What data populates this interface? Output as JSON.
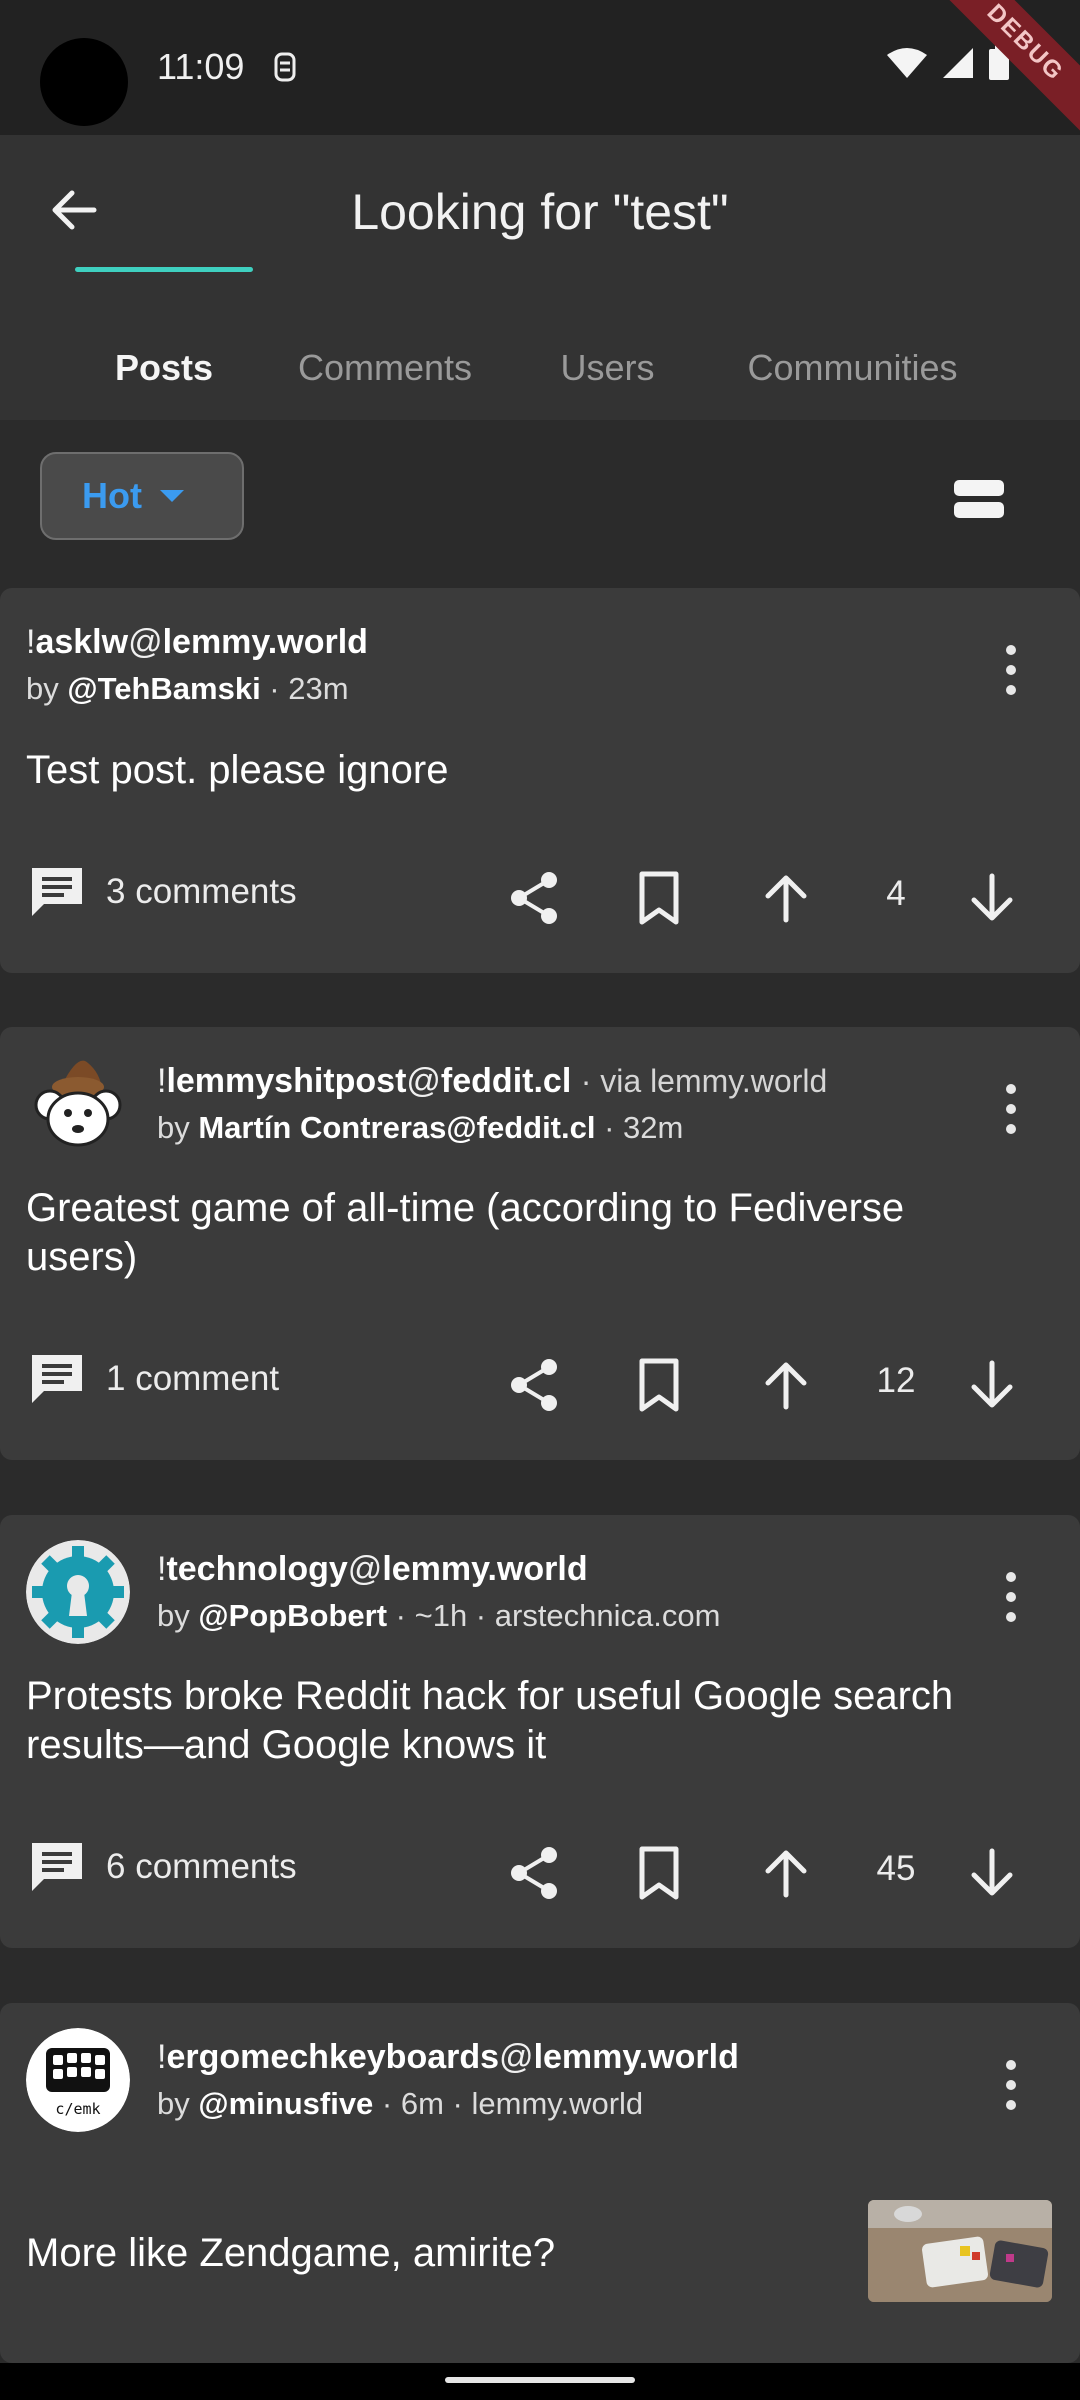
{
  "status": {
    "time": "11:09",
    "debug_label": "DEBUG"
  },
  "header": {
    "title": "Looking for \"test\""
  },
  "tabs": [
    "Posts",
    "Comments",
    "Users",
    "Communities"
  ],
  "sort": {
    "label": "Hot"
  },
  "posts": [
    {
      "community": "asklw",
      "instance": "lemmy.world",
      "via": "",
      "author": "@TehBamski",
      "age": "23m",
      "domain": "",
      "title": "Test post. please ignore",
      "comments": "3 comments",
      "score": "4"
    },
    {
      "community": "lemmyshitpost",
      "instance": "feddit.cl",
      "via": "via lemmy.world",
      "author": "Martín Contreras@feddit.cl",
      "age": "32m",
      "domain": "",
      "title": "Greatest game of all-time (according to Fediverse users)",
      "comments": "1 comment",
      "score": "12"
    },
    {
      "community": "technology",
      "instance": "lemmy.world",
      "via": "",
      "author": "@PopBobert",
      "age": "~1h",
      "domain": "arstechnica.com",
      "title": "Protests broke Reddit hack for useful Google search results—and Google knows it",
      "comments": "6 comments",
      "score": "45"
    },
    {
      "community": "ergomechkeyboards",
      "instance": "lemmy.world",
      "via": "",
      "author": "@minusfive",
      "age": "6m",
      "domain": "lemmy.world",
      "title": "More like Zendgame, amirite?",
      "avatar_text": "c/emk"
    }
  ],
  "colors": {
    "accent": "#3fd0c0",
    "sort_blue": "#3b9bf0",
    "card_bg": "#3b3b3b",
    "page_bg": "#2b2b2b"
  }
}
